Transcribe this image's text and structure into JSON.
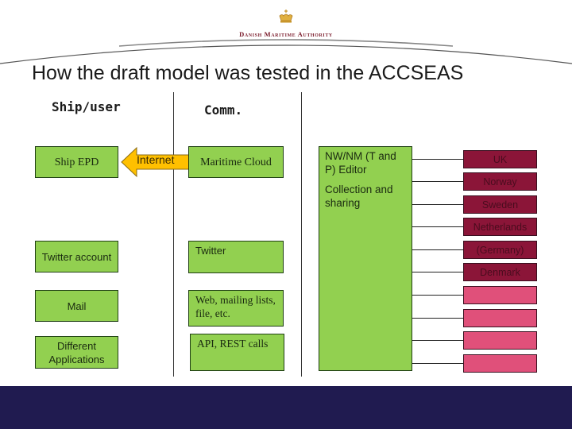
{
  "header": {
    "organization": "Danish Maritime Authority",
    "logo_icon": "crown-icon"
  },
  "title": "How the draft model was tested in the ACCSEAS",
  "columns": {
    "ship_user": "Ship/user",
    "comm": "Comm."
  },
  "ship_user_boxes": [
    {
      "label": "Ship EPD"
    },
    {
      "label": "Twitter account"
    },
    {
      "label": "Mail"
    },
    {
      "label": "Different Applications"
    }
  ],
  "arrow": {
    "label": "Internet",
    "direction": "left",
    "color": "#ffc000"
  },
  "comm_boxes": [
    {
      "label": "Maritime Cloud"
    },
    {
      "label": "Twitter"
    },
    {
      "label": "Web, mailing lists, file, etc."
    },
    {
      "label": "API, REST calls"
    }
  ],
  "editor_box": {
    "line1": "NW/NM (T and P) Editor",
    "line2": "Collection and sharing"
  },
  "countries": [
    {
      "label": "UK",
      "style": "dark"
    },
    {
      "label": "Norway",
      "style": "dark"
    },
    {
      "label": "Sweden",
      "style": "dark"
    },
    {
      "label": "Netherlands",
      "style": "dark"
    },
    {
      "label": "(Germany)",
      "style": "dark"
    },
    {
      "label": "Denmark",
      "style": "dark"
    },
    {
      "label": "",
      "style": "pink"
    },
    {
      "label": "",
      "style": "pink"
    },
    {
      "label": "",
      "style": "pink"
    },
    {
      "label": "",
      "style": "pink"
    }
  ],
  "colors": {
    "green_box": "#92d050",
    "country_dark": "#8b1538",
    "country_pink": "#e0507a",
    "footer": "#201b50",
    "arrow": "#ffc000",
    "brand": "#7a1a2a"
  }
}
